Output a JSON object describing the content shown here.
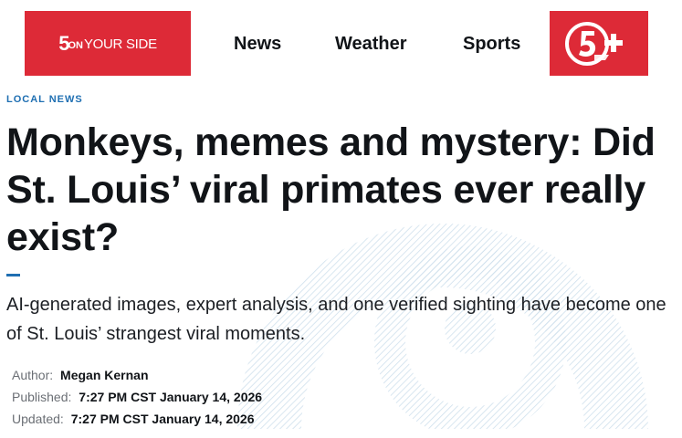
{
  "header": {
    "logo_left": {
      "five": "5",
      "on": "ON",
      "rest": "YOUR SIDE",
      "bg_color": "#dd2a37"
    },
    "nav": [
      {
        "label": "News"
      },
      {
        "label": "Weather"
      },
      {
        "label": "Sports"
      }
    ],
    "logo_right": {
      "icon": "5-plus-peacock-icon",
      "bg_color": "#dd2a37"
    }
  },
  "article": {
    "kicker": "LOCAL NEWS",
    "headline": "Monkeys, memes and mystery: Did St. Louis’ viral primates ever really exist?",
    "subheadline": "AI-generated images, expert analysis, and one verified sighting have become one of St. Louis’ strangest viral moments.",
    "accent_color": "#1f6fb2",
    "meta": {
      "author_label": "Author:",
      "author": "Megan Kernan",
      "published_label": "Published:",
      "published": "7:27 PM CST January 14, 2026",
      "updated_label": "Updated:",
      "updated": "7:27 PM CST January 14, 2026"
    }
  }
}
